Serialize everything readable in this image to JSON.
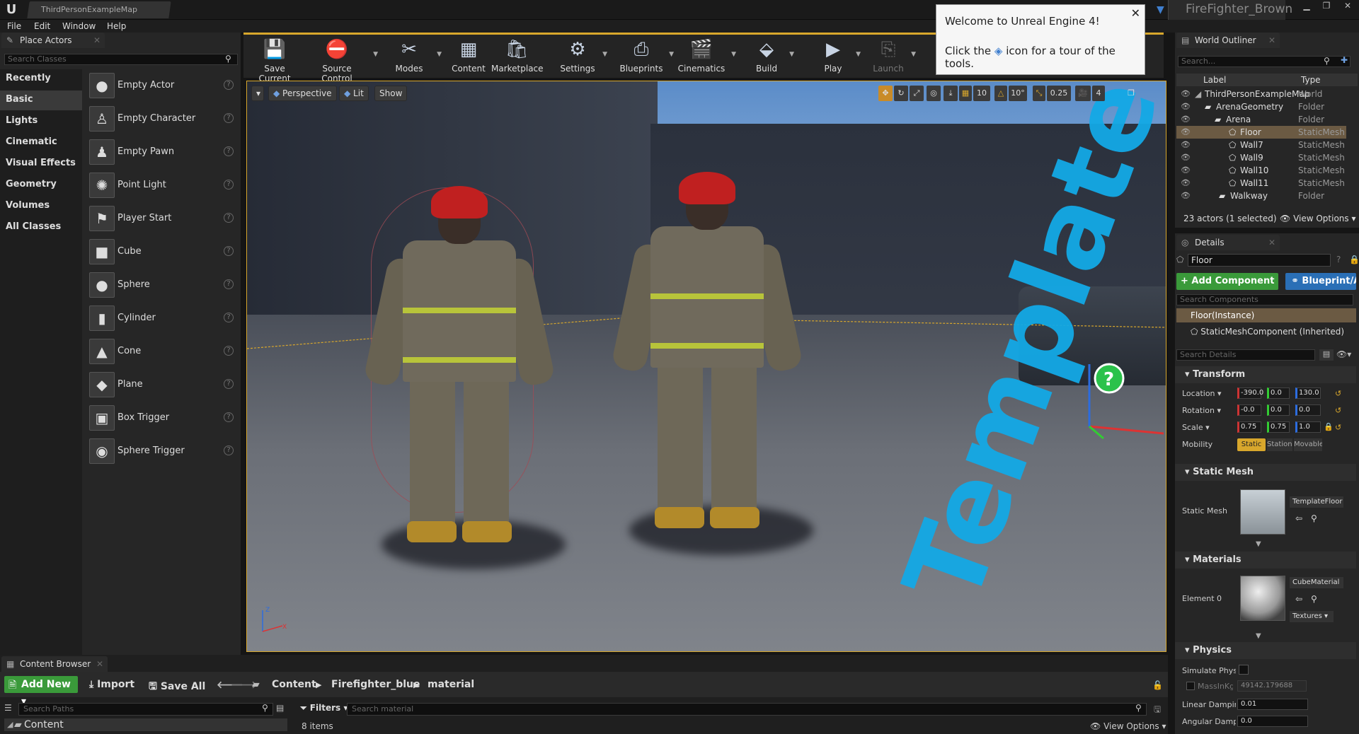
{
  "window": {
    "tab_title": "ThirdPersonExampleMap",
    "project_name": "FireFighter_Brown",
    "min": "▁",
    "max": "❐",
    "close": "✕"
  },
  "menu": [
    "File",
    "Edit",
    "Window",
    "Help"
  ],
  "place_actors": {
    "tab": "Place Actors",
    "search_placeholder": "Search Classes",
    "categories": [
      "Recently Placed",
      "Basic",
      "Lights",
      "Cinematic",
      "Visual Effects",
      "Geometry",
      "Volumes",
      "All Classes"
    ],
    "selected_category": "Basic",
    "actors": [
      "Empty Actor",
      "Empty Character",
      "Empty Pawn",
      "Point Light",
      "Player Start",
      "Cube",
      "Sphere",
      "Cylinder",
      "Cone",
      "Plane",
      "Box Trigger",
      "Sphere Trigger"
    ]
  },
  "toolbar": {
    "buttons": [
      "Save Current",
      "Source Control",
      "Modes",
      "Content",
      "Marketplace",
      "Settings",
      "Blueprints",
      "Cinematics",
      "Build",
      "Play",
      "Launch"
    ]
  },
  "viewport": {
    "view_mode": "Perspective",
    "lighting": "Lit",
    "show": "Show",
    "grid_snap": "10",
    "rot_snap": "10°",
    "scale_snap": "0.25",
    "camera_speed": "4",
    "floor_text": "Template"
  },
  "welcome": {
    "line1": "Welcome to Unreal Engine 4!",
    "line2_a": "Click the",
    "line2_b": "icon for a tour of the tools."
  },
  "outliner": {
    "tab": "World Outliner",
    "search_placeholder": "Search...",
    "col_label": "Label",
    "col_type": "Type",
    "rows": [
      {
        "label": "ThirdPersonExampleMap",
        "type": "World"
      },
      {
        "label": "ArenaGeometry",
        "type": "Folder"
      },
      {
        "label": "Arena",
        "type": "Folder"
      },
      {
        "label": "Floor",
        "type": "StaticMeshActor"
      },
      {
        "label": "Wall7",
        "type": "StaticMeshActor"
      },
      {
        "label": "Wall9",
        "type": "StaticMeshActor"
      },
      {
        "label": "Wall10",
        "type": "StaticMeshActor"
      },
      {
        "label": "Wall11",
        "type": "StaticMeshActor"
      },
      {
        "label": "Walkway",
        "type": "Folder"
      }
    ],
    "status": "23 actors (1 selected)",
    "view_options": "View Options"
  },
  "details": {
    "tab": "Details",
    "name": "Floor",
    "add_component": "+ Add Component",
    "blueprint": "Blueprint/Add Script",
    "search_components": "Search Components",
    "instance": "Floor(Instance)",
    "component": "StaticMeshComponent (Inherited)",
    "search_details": "Search Details",
    "transform": "Transform",
    "location_label": "Location",
    "rotation_label": "Rotation",
    "scale_label": "Scale",
    "mobility_label": "Mobility",
    "location": [
      "-390.0",
      "0.0",
      "130.0"
    ],
    "rotation": [
      "-0.0",
      "0.0",
      "0.0"
    ],
    "scale": [
      "0.75",
      "0.75",
      "1.0"
    ],
    "mobility": [
      "Static",
      "Stationary",
      "Movable"
    ],
    "static_mesh_section": "Static Mesh",
    "static_mesh_label": "Static Mesh",
    "static_mesh_value": "TemplateFloor",
    "materials_section": "Materials",
    "element0": "Element 0",
    "material_value": "CubeMaterial",
    "textures": "Textures",
    "physics_section": "Physics",
    "simulate": "Simulate Physics",
    "mass": "MassInKg",
    "mass_value": "49142.179688",
    "linear_damping": "Linear Damping",
    "linear_damping_value": "0.01",
    "angular_damping": "Angular Damping",
    "angular_damping_value": "0.0"
  },
  "content_browser": {
    "tab": "Content Browser",
    "add_new": "Add New",
    "import": "Import",
    "save_all": "Save All",
    "path": [
      "Content",
      "Firefighter_blue",
      "material"
    ],
    "search_paths": "Search Paths",
    "filters": "Filters",
    "search_material": "Search material",
    "tree_root": "Content",
    "items_count": "8 items",
    "view_options": "View Options"
  },
  "colors": {
    "accent": "#d8a72c",
    "selection": "#6b5a43",
    "add_green": "#3a9a3a",
    "blueprint_blue": "#2a6fb6",
    "floor_text": "#13a9e6"
  }
}
